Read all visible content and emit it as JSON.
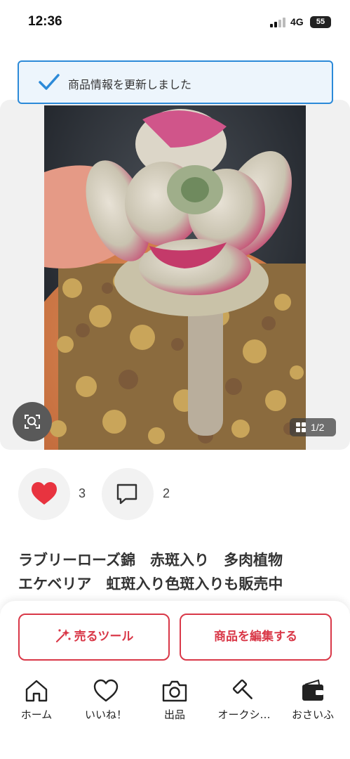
{
  "status_bar": {
    "time": "12:36",
    "network": "4G",
    "battery": "55"
  },
  "toast": {
    "message": "商品情報を更新しました",
    "icon": "check-icon"
  },
  "image": {
    "page_indicator": "1/2",
    "current_page": 1,
    "total_pages": 2
  },
  "reactions": {
    "likes": "3",
    "comments": "2"
  },
  "product": {
    "title_line1": "ラブリーローズ錦　赤斑入り　多肉植物",
    "title_line2": "エケベリア　虹斑入り色斑入りも販売中"
  },
  "actions": {
    "sell_tool": "売るツール",
    "edit_product": "商品を編集する"
  },
  "tabs": [
    {
      "label": "ホーム",
      "icon": "home-icon"
    },
    {
      "label": "いいね！",
      "icon": "heart-icon"
    },
    {
      "label": "出品",
      "icon": "camera-icon"
    },
    {
      "label": "オークシ…",
      "icon": "auction-hammer-icon"
    },
    {
      "label": "おさいふ",
      "icon": "wallet-icon"
    }
  ],
  "colors": {
    "accent": "#d93848",
    "toast_border": "#2c8ad8",
    "like_heart": "#e8333f"
  }
}
